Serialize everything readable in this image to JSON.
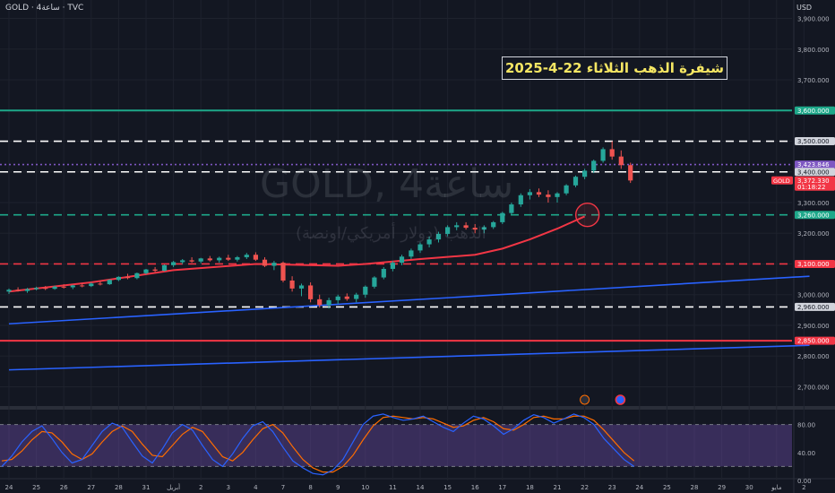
{
  "symbol_line": "GOLD · 4ساعة · TVC",
  "currency": "USD",
  "headline": "شيفرة الذهب الثلاثاء 22-4-2025",
  "watermark": {
    "symbol": "GOLD, 4ساعة",
    "description": "الذهب (دولار أمريكي/اونصة)"
  },
  "colors": {
    "background": "#131722",
    "grid": "#1e222d",
    "up": "#26a69a",
    "down": "#ef5350",
    "green_line": "#1ea88a",
    "red_line": "#f23645",
    "ma_line": "#f23645",
    "trend_line": "#2962ff",
    "rsi_band": "#7e57c2",
    "rsi_k": "#2962ff",
    "rsi_d": "#ff6d00"
  },
  "chart_data": {
    "type": "candlestick",
    "instrument": "GOLD",
    "timeframe": "4ساعة",
    "y_axis": {
      "ticks": [
        "3,900.000",
        "3,800.000",
        "3,700.000",
        "3,600.000",
        "3,500.000",
        "3,400.000",
        "3,300.000",
        "3,200.000",
        "3,100.000",
        "3,000.000",
        "2,900.000",
        "2,800.000",
        "2,700.000"
      ],
      "tick_values": [
        3900,
        3800,
        3700,
        3600,
        3500,
        3400,
        3300,
        3200,
        3100,
        3000,
        2900,
        2800,
        2700
      ],
      "ylim": [
        2640,
        3960
      ]
    },
    "x_axis": {
      "labels": [
        "24",
        "25",
        "26",
        "27",
        "28",
        "31",
        "أبريل",
        "2",
        "3",
        "4",
        "7",
        "8",
        "9",
        "10",
        "11",
        "14",
        "15",
        "16",
        "17",
        "18",
        "21",
        "22",
        "23",
        "24",
        "25",
        "28",
        "29",
        "30",
        "مايو",
        "2"
      ]
    },
    "price_tags": [
      {
        "label": "3,600.000",
        "value": 3600,
        "color": "#1ea88a"
      },
      {
        "label": "3,500.000",
        "value": 3500,
        "color": "#d1d4dc"
      },
      {
        "label": "3,423.846",
        "value": 3423.846,
        "color": "#7e57c2"
      },
      {
        "label": "3,400.000",
        "value": 3400,
        "color": "#d1d4dc"
      },
      {
        "label": "3,372.330",
        "value": 3372.33,
        "color": "#f23645",
        "symbol": "GOLD",
        "countdown": "01:18:22"
      },
      {
        "label": "3,260.000",
        "value": 3260,
        "color": "#1ea88a"
      },
      {
        "label": "3,100.000",
        "value": 3100,
        "color": "#f23645"
      },
      {
        "label": "2,960.000",
        "value": 2960,
        "color": "#d1d4dc"
      },
      {
        "label": "2,850.000",
        "value": 2850,
        "color": "#f23645"
      }
    ],
    "horizontal_levels": [
      {
        "value": 3600,
        "style": "solid",
        "color": "#1ea88a"
      },
      {
        "value": 3500,
        "style": "dashed",
        "color": "#ffffff"
      },
      {
        "value": 3400,
        "style": "dashed",
        "color": "#ffffff"
      },
      {
        "value": 3423.846,
        "style": "dotted",
        "color": "#7e57c2"
      },
      {
        "value": 3260,
        "style": "dashed",
        "color": "#1ea88a"
      },
      {
        "value": 3100,
        "style": "dashed",
        "color": "#f23645"
      },
      {
        "value": 2960,
        "style": "dashed",
        "color": "#ffffff"
      },
      {
        "value": 2850,
        "style": "solid",
        "color": "#f23645"
      }
    ],
    "trend_lines": [
      {
        "from": [
          0,
          2905
        ],
        "to": [
          29.2,
          3060
        ]
      },
      {
        "from": [
          0,
          2755
        ],
        "to": [
          29.2,
          2835
        ]
      }
    ],
    "moving_average": [
      [
        0,
        3010
      ],
      [
        3,
        3040
      ],
      [
        6,
        3080
      ],
      [
        9,
        3100
      ],
      [
        10,
        3098
      ],
      [
        12,
        3094
      ],
      [
        13,
        3100
      ],
      [
        15,
        3116
      ],
      [
        17,
        3130
      ],
      [
        18,
        3150
      ],
      [
        19,
        3180
      ],
      [
        20,
        3215
      ],
      [
        21,
        3255
      ]
    ],
    "candles": [
      [
        0.0,
        3010,
        3020,
        3002,
        3016
      ],
      [
        0.33,
        3016,
        3024,
        3010,
        3012
      ],
      [
        0.67,
        3012,
        3022,
        3006,
        3018
      ],
      [
        1.0,
        3018,
        3026,
        3014,
        3022
      ],
      [
        1.33,
        3022,
        3028,
        3015,
        3019
      ],
      [
        1.67,
        3019,
        3030,
        3016,
        3026
      ],
      [
        2.0,
        3026,
        3034,
        3020,
        3024
      ],
      [
        2.33,
        3024,
        3032,
        3018,
        3030
      ],
      [
        2.67,
        3030,
        3038,
        3024,
        3028
      ],
      [
        3.0,
        3028,
        3040,
        3025,
        3036
      ],
      [
        3.33,
        3036,
        3044,
        3030,
        3034
      ],
      [
        3.67,
        3034,
        3050,
        3032,
        3048
      ],
      [
        4.0,
        3048,
        3060,
        3044,
        3058
      ],
      [
        4.33,
        3058,
        3068,
        3050,
        3054
      ],
      [
        4.67,
        3054,
        3072,
        3050,
        3070
      ],
      [
        5.0,
        3070,
        3084,
        3066,
        3082
      ],
      [
        5.33,
        3082,
        3090,
        3074,
        3078
      ],
      [
        5.67,
        3078,
        3098,
        3076,
        3096
      ],
      [
        6.0,
        3096,
        3110,
        3090,
        3106
      ],
      [
        6.33,
        3106,
        3116,
        3100,
        3112
      ],
      [
        6.67,
        3112,
        3122,
        3104,
        3108
      ],
      [
        7.0,
        3108,
        3120,
        3102,
        3118
      ],
      [
        7.33,
        3118,
        3126,
        3108,
        3112
      ],
      [
        7.67,
        3112,
        3124,
        3104,
        3120
      ],
      [
        8.0,
        3120,
        3130,
        3110,
        3114
      ],
      [
        8.33,
        3114,
        3126,
        3108,
        3122
      ],
      [
        8.67,
        3122,
        3136,
        3116,
        3130
      ],
      [
        9.0,
        3130,
        3138,
        3110,
        3114
      ],
      [
        9.33,
        3114,
        3122,
        3090,
        3094
      ],
      [
        9.67,
        3094,
        3110,
        3080,
        3104
      ],
      [
        10.0,
        3104,
        3108,
        3040,
        3046
      ],
      [
        10.33,
        3046,
        3060,
        3010,
        3020
      ],
      [
        10.67,
        3020,
        3036,
        2995,
        3030
      ],
      [
        11.0,
        3030,
        3040,
        2975,
        2985
      ],
      [
        11.33,
        2985,
        3000,
        2958,
        2966
      ],
      [
        11.67,
        2966,
        2990,
        2955,
        2982
      ],
      [
        12.0,
        2982,
        3000,
        2970,
        2994
      ],
      [
        12.33,
        2994,
        3004,
        2980,
        2986
      ],
      [
        12.67,
        2986,
        3006,
        2975,
        3000
      ],
      [
        13.0,
        3000,
        3030,
        2990,
        3026
      ],
      [
        13.33,
        3026,
        3060,
        3020,
        3056
      ],
      [
        13.67,
        3056,
        3090,
        3050,
        3084
      ],
      [
        14.0,
        3084,
        3110,
        3076,
        3104
      ],
      [
        14.33,
        3104,
        3130,
        3096,
        3124
      ],
      [
        14.67,
        3124,
        3150,
        3116,
        3144
      ],
      [
        15.0,
        3144,
        3170,
        3136,
        3164
      ],
      [
        15.33,
        3164,
        3190,
        3154,
        3180
      ],
      [
        15.67,
        3180,
        3205,
        3170,
        3198
      ],
      [
        16.0,
        3198,
        3226,
        3190,
        3220
      ],
      [
        16.33,
        3220,
        3236,
        3210,
        3226
      ],
      [
        16.67,
        3226,
        3236,
        3212,
        3218
      ],
      [
        17.0,
        3218,
        3230,
        3200,
        3212
      ],
      [
        17.33,
        3212,
        3226,
        3200,
        3220
      ],
      [
        17.67,
        3220,
        3240,
        3214,
        3236
      ],
      [
        18.0,
        3236,
        3270,
        3230,
        3266
      ],
      [
        18.33,
        3266,
        3300,
        3260,
        3294
      ],
      [
        18.67,
        3294,
        3330,
        3286,
        3324
      ],
      [
        19.0,
        3324,
        3344,
        3310,
        3334
      ],
      [
        19.33,
        3334,
        3346,
        3318,
        3326
      ],
      [
        19.67,
        3326,
        3340,
        3300,
        3318
      ],
      [
        20.0,
        3318,
        3334,
        3300,
        3330
      ],
      [
        20.33,
        3330,
        3360,
        3324,
        3356
      ],
      [
        20.67,
        3356,
        3388,
        3350,
        3384
      ],
      [
        21.0,
        3384,
        3410,
        3376,
        3404
      ],
      [
        21.33,
        3404,
        3440,
        3396,
        3436
      ],
      [
        21.67,
        3436,
        3480,
        3430,
        3474
      ],
      [
        22.0,
        3474,
        3500,
        3440,
        3450
      ],
      [
        22.33,
        3450,
        3470,
        3410,
        3422
      ],
      [
        22.67,
        3422,
        3430,
        3364,
        3372
      ]
    ],
    "rsi_panel": {
      "type": "stochastic_rsi",
      "ticks": [
        "80.00",
        "40.00",
        "0.00"
      ],
      "tick_values": [
        80,
        40,
        0
      ],
      "upper_band": 80,
      "lower_band": 20,
      "k": [
        20,
        35,
        55,
        70,
        78,
        60,
        40,
        25,
        30,
        50,
        70,
        82,
        76,
        55,
        35,
        25,
        45,
        68,
        80,
        72,
        50,
        30,
        20,
        38,
        60,
        78,
        84,
        70,
        48,
        28,
        18,
        10,
        8,
        15,
        30,
        55,
        80,
        92,
        95,
        90,
        86,
        88,
        92,
        84,
        76,
        70,
        82,
        92,
        88,
        78,
        66,
        74,
        86,
        94,
        90,
        82,
        88,
        95,
        90,
        80,
        60,
        45,
        30,
        20
      ],
      "d": [
        28,
        30,
        42,
        58,
        70,
        68,
        55,
        38,
        30,
        38,
        55,
        70,
        78,
        70,
        52,
        36,
        34,
        50,
        66,
        76,
        70,
        52,
        34,
        28,
        40,
        58,
        74,
        80,
        68,
        48,
        30,
        18,
        12,
        12,
        20,
        36,
        58,
        78,
        90,
        92,
        90,
        88,
        90,
        88,
        82,
        76,
        78,
        86,
        90,
        84,
        74,
        72,
        80,
        90,
        92,
        88,
        88,
        92,
        92,
        86,
        72,
        56,
        40,
        28
      ]
    },
    "event_markers": [
      {
        "x": 21.0,
        "kind": "lightning"
      },
      {
        "x": 22.3,
        "kind": "flag"
      }
    ],
    "highlight_circle": {
      "x": 21.1,
      "y": 3260
    }
  }
}
